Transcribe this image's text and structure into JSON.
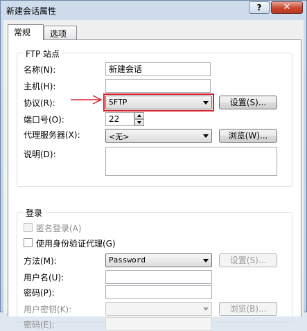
{
  "window": {
    "title": "新建会话属性",
    "help_label": "?",
    "close_label": "✕"
  },
  "tabs": [
    {
      "label": "常规",
      "active": true
    },
    {
      "label": "选项",
      "active": false
    }
  ],
  "ftp_site": {
    "group_title": "FTP 站点",
    "name_label": "名称(N):",
    "name_value": "新建会话",
    "host_label": "主机(H):",
    "host_value": "",
    "protocol_label": "协议(R):",
    "protocol_value": "SFTP",
    "settings_label": "设置(S)...",
    "port_label": "端口号(O):",
    "port_value": "22",
    "proxy_label": "代理服务器(X):",
    "proxy_value": "<无>",
    "browse_label": "浏览(W)...",
    "desc_label": "说明(D):",
    "desc_value": ""
  },
  "login": {
    "group_title": "登录",
    "anon_label": "匿名登录(A)",
    "anon_checked": false,
    "auth_proxy_label": "使用身份验证代理(G)",
    "auth_proxy_checked": false,
    "method_label": "方法(M):",
    "method_value": "Password",
    "method_settings_label": "设置(S)...",
    "username_label": "用户名(U):",
    "username_value": "",
    "password_label": "密码(P):",
    "password_value": "",
    "userkey_label": "用户密钥(K):",
    "userkey_value": "",
    "userkey_browse_label": "浏览(B)...",
    "passphrase_label": "密码(E):",
    "passphrase_value": ""
  },
  "colors": {
    "highlight": "#d9212a",
    "arrow": "#d9212a"
  }
}
